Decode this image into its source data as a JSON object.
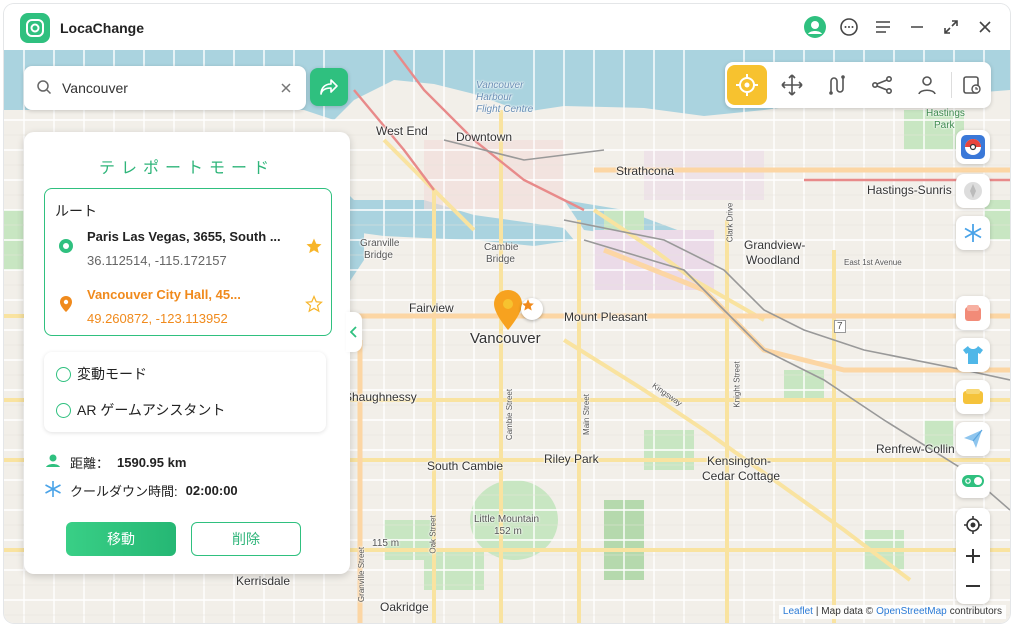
{
  "app": {
    "title": "LocaChange"
  },
  "search": {
    "value": "Vancouver"
  },
  "panel": {
    "title": "テレポートモード",
    "route_label": "ルート",
    "from": {
      "name": "Paris Las Vegas, 3655, South ...",
      "coords": "36.112514, -115.172157"
    },
    "to": {
      "name": "Vancouver City Hall, 45...",
      "coords": "49.260872, -123.113952"
    },
    "modes": [
      {
        "label": "変動モード"
      },
      {
        "label": "AR ゲームアシスタント"
      }
    ],
    "distance_label": "距離：",
    "distance_value": "1590.95 km",
    "cooldown_label": "クールダウン時間:",
    "cooldown_value": "02:00:00",
    "move_button": "移動",
    "delete_button": "削除"
  },
  "map": {
    "labels": {
      "west_end": "West End",
      "downtown": "Downtown",
      "harbour": "Vancouver Harbour Flight Centre",
      "harbour1": "Vancouver",
      "harbour2": "Harbour",
      "harbour3": "Flight Centre",
      "strathcona": "Strathcona",
      "hastings": "Hastings-Sunris",
      "granville1": "Granville",
      "granville2": "Bridge",
      "cambie1": "Cambie",
      "cambie2": "Bridge",
      "grandview1": "Grandview-",
      "grandview2": "Woodland",
      "fairview": "Fairview",
      "mount_pleasant": "Mount Pleasant",
      "vancouver": "Vancouver",
      "shaughnessy": "Shaughnessy",
      "riley_park": "Riley Park",
      "south_cambie": "South Cambie",
      "kensington1": "Kensington-",
      "kensington2": "Cedar Cottage",
      "renfrew": "Renfrew-Collin",
      "little_mountain1": "Little Mountain",
      "little_mountain2": "152 m",
      "elev_115": "115 m",
      "kerrisdale": "Kerrisdale",
      "oakridge": "Oakridge",
      "hastings_park1": "Hastings",
      "hastings_park2": "Park",
      "east_1st": "East 1st Avenue",
      "clark": "Clark Drive",
      "kingsway": "Kingsway",
      "main": "Main Street",
      "cambie_st": "Cambie Street",
      "knight": "Knight Street",
      "oak": "Oak Street",
      "granville_st": "Granville Street",
      "route7": "7"
    },
    "attribution": {
      "leaflet": "Leaflet",
      "sep": "| Map data ©",
      "osm": "OpenStreetMap",
      "contrib": "contributors"
    }
  },
  "colors": {
    "accent": "#2fc07f",
    "orange": "#f08a1c",
    "yellow": "#f7c22f"
  }
}
